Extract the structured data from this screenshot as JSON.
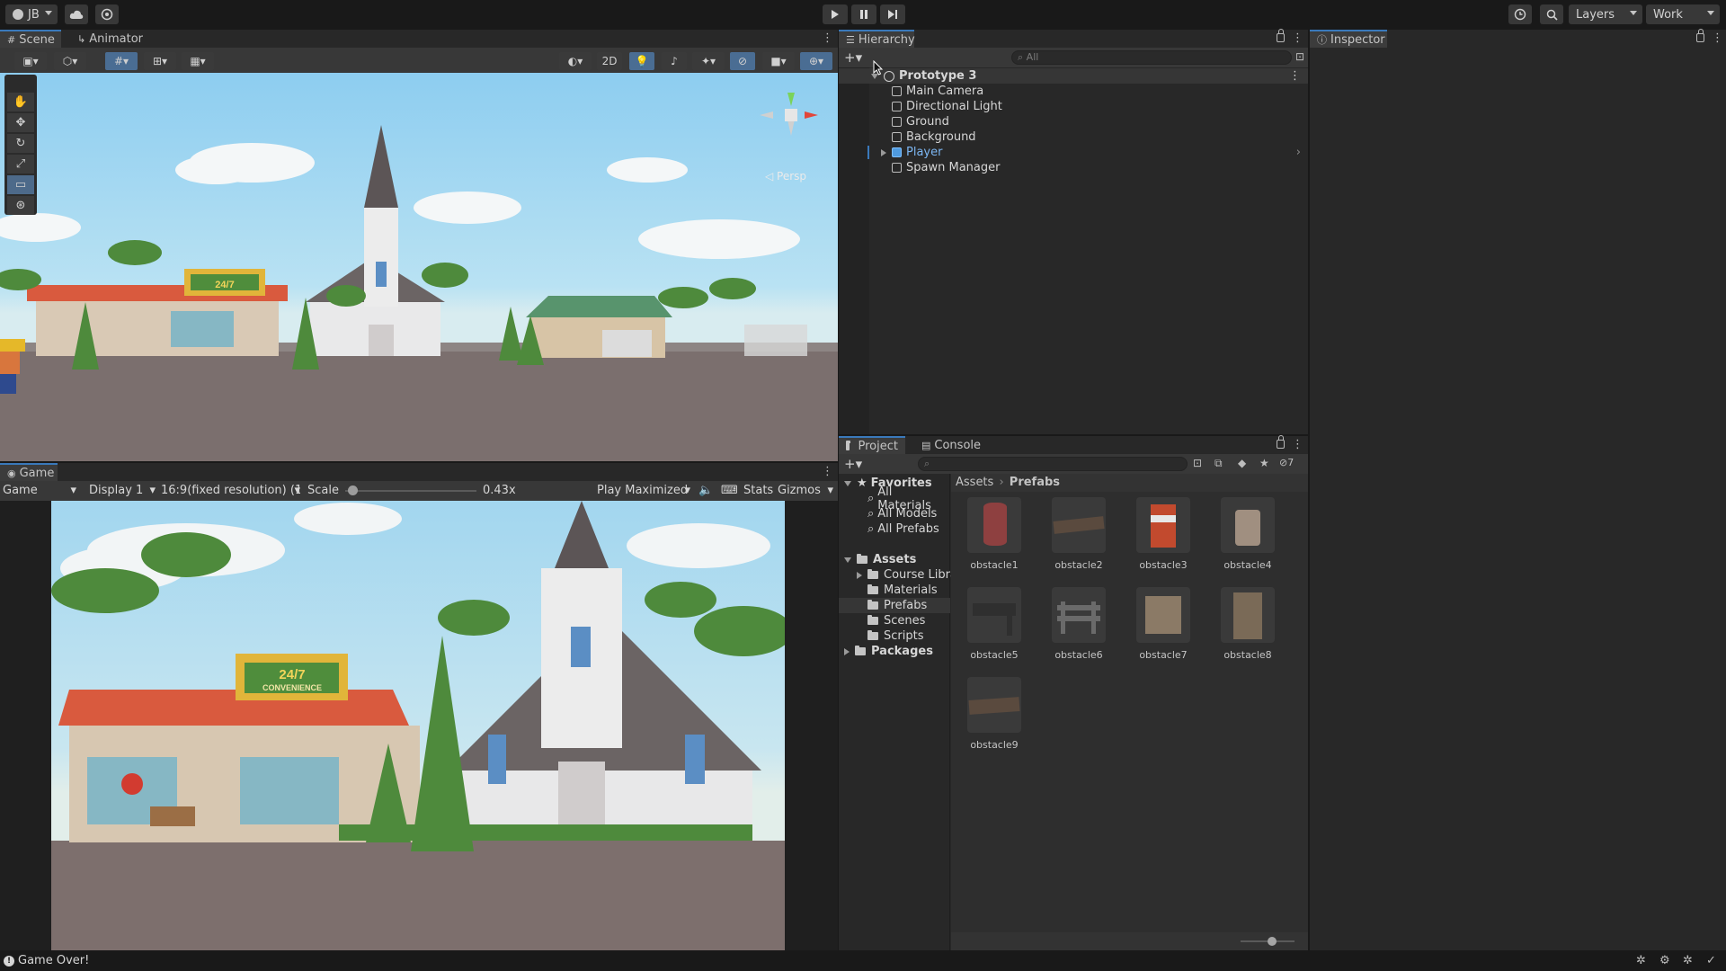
{
  "toolbar": {
    "account_label": "JB",
    "play_icon": "play-icon",
    "pause_icon": "pause-icon",
    "step_icon": "step-icon",
    "layers_label": "Layers",
    "layout_label": "Work"
  },
  "scene_panel": {
    "tabs": [
      {
        "label": "Scene",
        "icon": "hash-icon"
      },
      {
        "label": "Animator",
        "icon": "animator-icon"
      }
    ],
    "mode_2d": "2D",
    "persp_label": "Persp",
    "tools": [
      "hand-tool",
      "move-tool",
      "rotate-tool",
      "scale-tool",
      "rect-tool",
      "transform-tool"
    ],
    "shop_sign": "24/7",
    "shop_sub": "CONVENIENCE"
  },
  "game_panel": {
    "tab_label": "Game",
    "view_select": "Game",
    "display_select": "Display 1",
    "aspect_select": "16:9(fixed resolution) (192",
    "scale_label": "Scale",
    "scale_value": "0.43x",
    "scale_fraction": 0.02,
    "play_mode": "Play Maximized",
    "stats_label": "Stats",
    "gizmos_label": "Gizmos"
  },
  "hierarchy": {
    "tab_label": "Hierarchy",
    "search_placeholder": "All",
    "scene_name": "Prototype 3",
    "items": [
      {
        "label": "Main Camera",
        "type": "gameobject"
      },
      {
        "label": "Directional Light",
        "type": "gameobject"
      },
      {
        "label": "Ground",
        "type": "gameobject"
      },
      {
        "label": "Background",
        "type": "gameobject"
      },
      {
        "label": "Player",
        "type": "prefab"
      },
      {
        "label": "Spawn Manager",
        "type": "gameobject"
      }
    ]
  },
  "inspector": {
    "tab_label": "Inspector"
  },
  "project": {
    "tabs": [
      {
        "label": "Project"
      },
      {
        "label": "Console"
      }
    ],
    "hidden_count": "7",
    "favorites_label": "Favorites",
    "favorites": [
      "All Materials",
      "All Models",
      "All Prefabs"
    ],
    "assets_label": "Assets",
    "asset_folders": [
      "Course Librar",
      "Materials",
      "Prefabs",
      "Scenes",
      "Scripts"
    ],
    "packages_label": "Packages",
    "breadcrumb": [
      "Assets",
      "Prefabs"
    ],
    "items": [
      "obstacle1",
      "obstacle2",
      "obstacle3",
      "obstacle4",
      "obstacle5",
      "obstacle6",
      "obstacle7",
      "obstacle8",
      "obstacle9"
    ]
  },
  "status_bar": {
    "message": "Game Over!"
  },
  "colors": {
    "accent": "#3a79bb",
    "prefab_blue": "#7cb6f2",
    "sky": "#9fd3ef",
    "ground": "#7b6f6e"
  }
}
